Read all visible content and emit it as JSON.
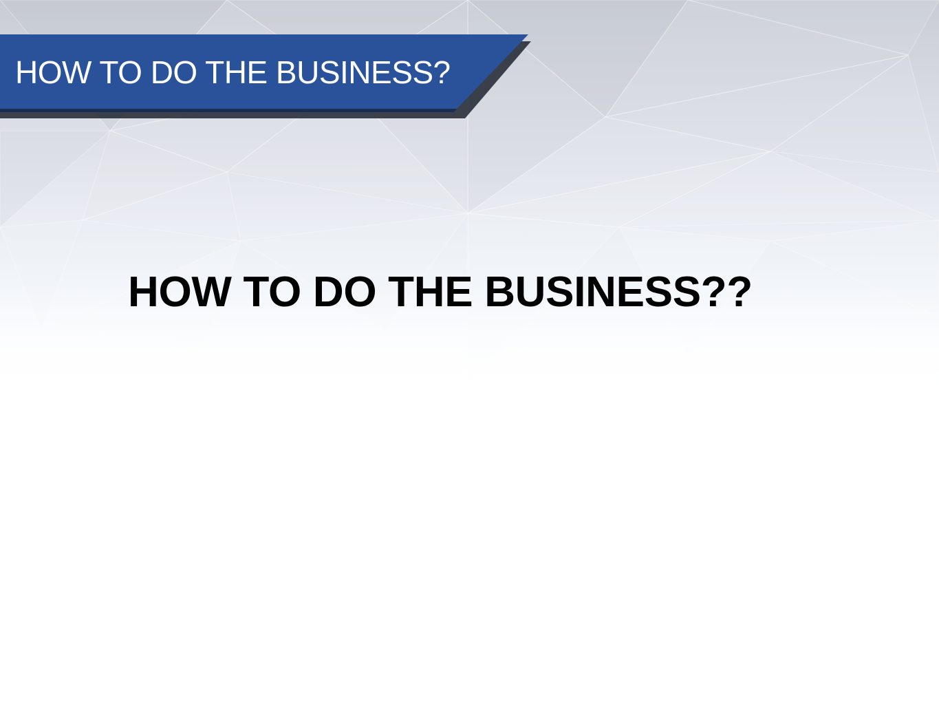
{
  "slide": {
    "banner_title": "HOW TO DO THE BUSINESS?",
    "heading": "HOW TO DO THE BUSINESS??"
  },
  "colors": {
    "banner": "#2a529a",
    "banner_shadow": "#1f2430",
    "heading_text": "#000000",
    "background_top": "#c9ccd4",
    "background_bottom": "#ffffff"
  }
}
